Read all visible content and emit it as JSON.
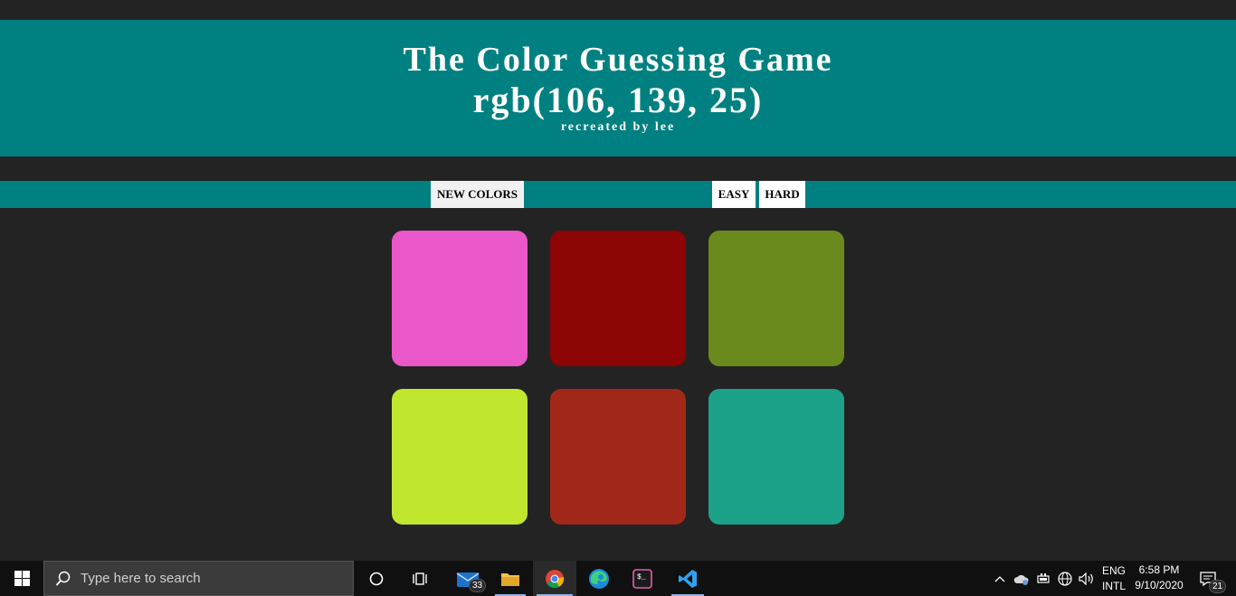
{
  "header": {
    "title": "The Color Guessing Game",
    "rgb_target": "rgb(106, 139, 25)",
    "credit": "recreated by lee",
    "bg_color": "#008080"
  },
  "controls": {
    "new_colors_label": "NEW COLORS",
    "easy_label": "EASY",
    "hard_label": "HARD"
  },
  "squares": [
    {
      "color": "#e957c9"
    },
    {
      "color": "#8c0404"
    },
    {
      "color": "#6b8a1d"
    },
    {
      "color": "#c0e62e"
    },
    {
      "color": "#a12818"
    },
    {
      "color": "#1ca289"
    }
  ],
  "taskbar": {
    "search_placeholder": "Type here to search",
    "mail_badge": "33",
    "lang_top": "ENG",
    "lang_bottom": "INTL",
    "time": "6:58 PM",
    "date": "9/10/2020",
    "notification_count": "21",
    "icons": [
      "windows-start-icon",
      "search-icon",
      "cortana-icon",
      "task-view-icon",
      "mail-icon",
      "file-explorer-icon",
      "chrome-icon",
      "edge-icon",
      "terminal-icon",
      "vscode-icon",
      "chevron-up-icon",
      "onedrive-icon",
      "battery-icon",
      "network-icon",
      "volume-icon",
      "action-center-icon"
    ]
  }
}
